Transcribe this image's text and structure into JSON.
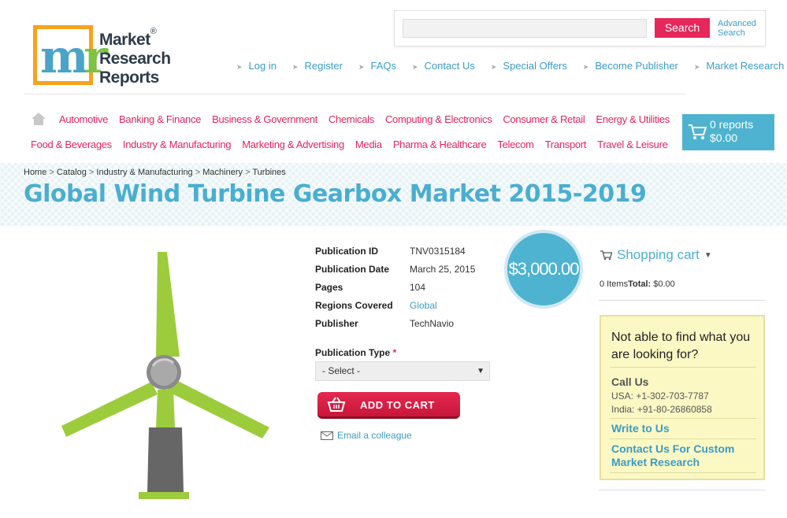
{
  "logo": {
    "line1": "Market",
    "line2": "Research",
    "line3": "Reports",
    "registered": "®",
    "letter1": "m",
    "letter2": "r"
  },
  "search": {
    "placeholder": "",
    "button": "Search",
    "advanced_line1": "Advanced",
    "advanced_line2": "Search"
  },
  "top_links": [
    "Log in",
    "Register",
    "FAQs",
    "Contact Us",
    "Special Offers",
    "Become Publisher",
    "Market Research Blog"
  ],
  "nav_row1": [
    "Automotive",
    "Banking & Finance",
    "Business & Government",
    "Chemicals",
    "Computing & Electronics",
    "Consumer & Retail",
    "Energy & Utilities"
  ],
  "nav_row2": [
    "Food & Beverages",
    "Industry & Manufacturing",
    "Marketing & Advertising",
    "Media",
    "Pharma & Healthcare",
    "Telecom",
    "Transport",
    "Travel & Leisure"
  ],
  "cart": {
    "reports": "0 reports",
    "amount": "$0.00"
  },
  "breadcrumb": [
    "Home",
    "Catalog",
    "Industry & Manufacturing",
    "Machinery",
    "Turbines"
  ],
  "breadcrumb_sep": ">",
  "title": "Global Wind Turbine Gearbox Market 2015-2019",
  "details": [
    {
      "label": "Publication ID",
      "value": "TNV0315184"
    },
    {
      "label": "Publication Date",
      "value": "March 25, 2015"
    },
    {
      "label": "Pages",
      "value": "104"
    },
    {
      "label": "Regions Covered",
      "value": "Global"
    },
    {
      "label": "Publisher",
      "value": "TechNavio"
    }
  ],
  "price": "$3,000.00",
  "publication_type": {
    "label": "Publication Type",
    "required_mark": "*",
    "selected": "- Select -"
  },
  "add_to_cart": "ADD TO CART",
  "email_colleague": "Email a colleague",
  "shopping_cart": {
    "title": "Shopping cart",
    "items": "0 Items",
    "total_label": "Total:",
    "total_value": "$0.00"
  },
  "help": {
    "question": "Not able to find what you are looking for?",
    "call_us": "Call Us",
    "usa": "USA: +1-302-703-7787",
    "india": "India: +91-80-26860858",
    "write": "Write to Us",
    "custom": "Contact Us For Custom Market Research"
  },
  "colors": {
    "accent_blue": "#4db3d0",
    "accent_pink": "#e0245e",
    "logo_orange": "#f7a21b",
    "turbine_green": "#9ccc3c",
    "help_bg": "#fbf8c4"
  }
}
